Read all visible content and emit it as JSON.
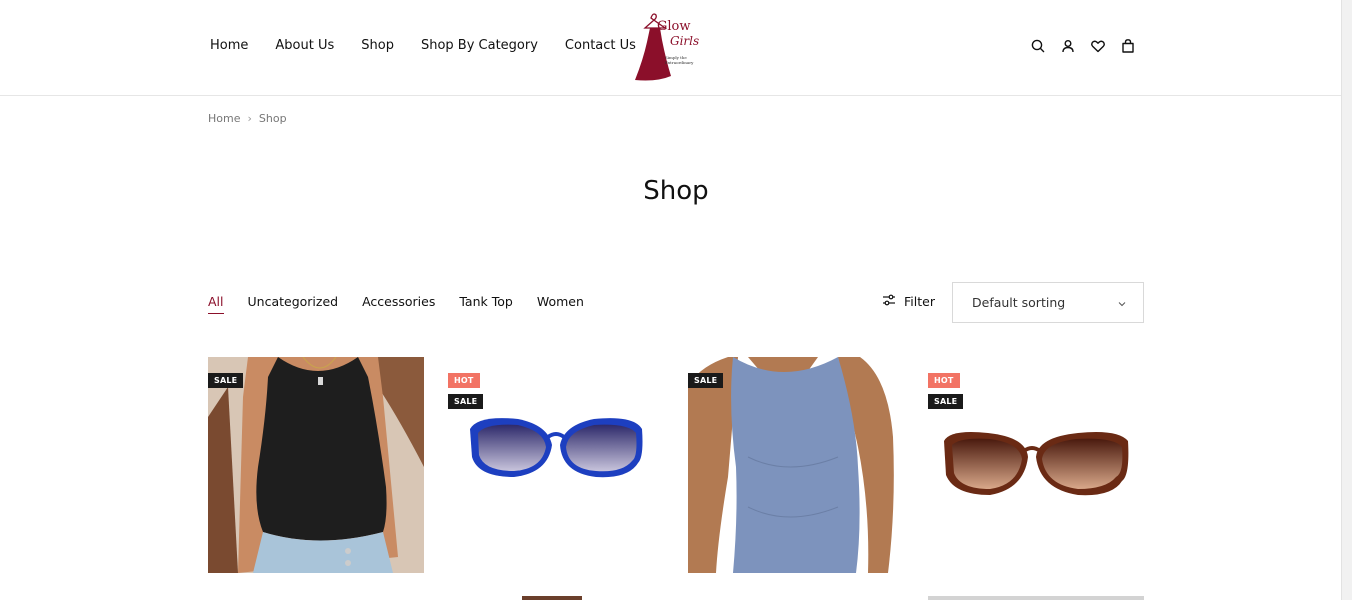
{
  "nav": {
    "items": [
      "Home",
      "About Us",
      "Shop",
      "Shop By Category",
      "Contact Us"
    ]
  },
  "logo": {
    "line1": "Glow",
    "line2": "Girls",
    "tagline1": "Simply the",
    "tagline2": "Extraordinary"
  },
  "header_icons": [
    "search-icon",
    "user-icon",
    "heart-icon",
    "bag-icon"
  ],
  "breadcrumb": {
    "home": "Home",
    "current": "Shop"
  },
  "page": {
    "title": "Shop"
  },
  "categories": [
    "All",
    "Uncategorized",
    "Accessories",
    "Tank Top",
    "Women"
  ],
  "active_category": "All",
  "filter": {
    "label": "Filter"
  },
  "sorting": {
    "selected": "Default sorting"
  },
  "products": [
    {
      "badges": [
        "SALE"
      ]
    },
    {
      "badges": [
        "HOT",
        "SALE"
      ]
    },
    {
      "badges": [
        "SALE"
      ]
    },
    {
      "badges": [
        "HOT",
        "SALE"
      ]
    }
  ],
  "colors": {
    "accent": "#8b0f2a",
    "sale_badge": "#1a1a1a",
    "hot_badge": "#f27364"
  }
}
